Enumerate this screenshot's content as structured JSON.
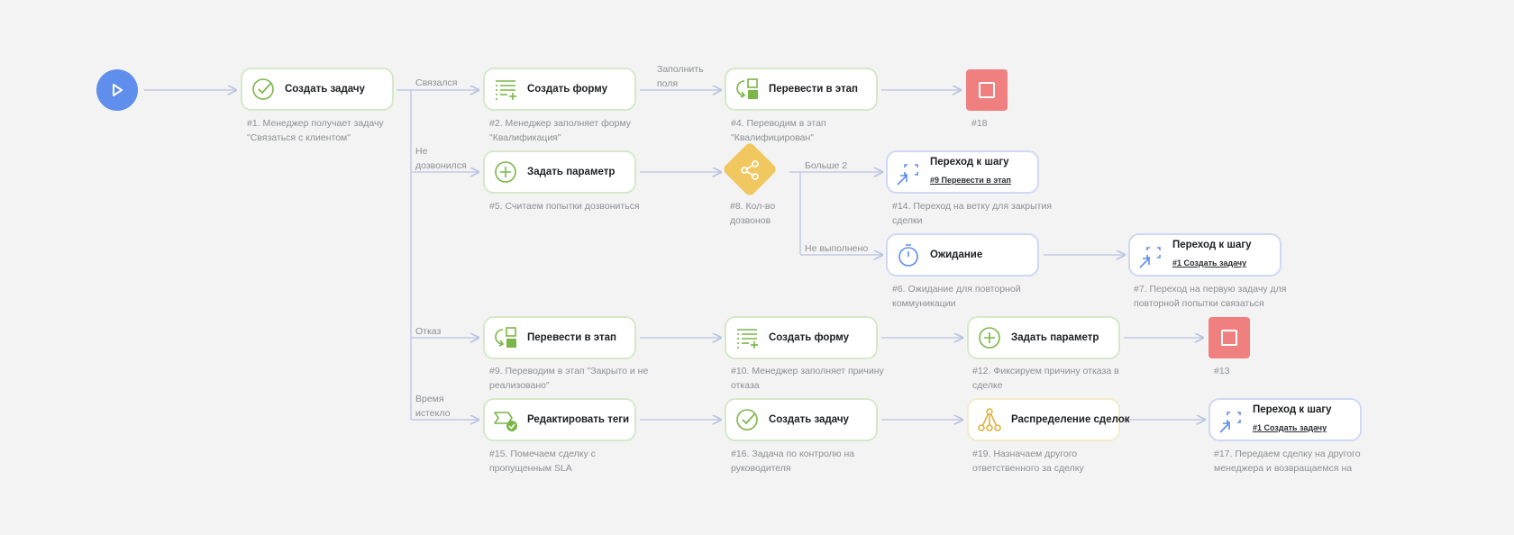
{
  "nodes": {
    "n1": {
      "title": "Создать задачу",
      "caption": "#1. Менеджер получает задачу \"Связаться с клиентом\""
    },
    "n2": {
      "title": "Создать форму",
      "caption": "#2. Менеджер заполняет форму \"Квалификация\""
    },
    "n4": {
      "title": "Перевести в этап",
      "caption": "#4. Переводим в этап \"Квалифицирован\""
    },
    "n18": {
      "caption": "#18"
    },
    "n5": {
      "title": "Задать параметр",
      "caption": "#5. Считаем попытки дозвониться"
    },
    "n8": {
      "caption": "#8. Кол-во дозвонов"
    },
    "n14": {
      "title": "Переход к шагу",
      "link": "#9 Перевести в этап",
      "caption": "#14. Переход на ветку для закрытия сделки"
    },
    "n6": {
      "title": "Ожидание",
      "caption": "#6. Ожидание для повторной коммуникации"
    },
    "n7": {
      "title": "Переход к шагу",
      "link": "#1 Создать задачу",
      "caption": "#7. Переход на первую задачу для повторной попытки связаться"
    },
    "n9": {
      "title": "Перевести в этап",
      "caption": "#9. Переводим в этап \"Закрыто и не реализовано\""
    },
    "n10": {
      "title": "Создать форму",
      "caption": "#10. Менеджер заполняет причину отказа"
    },
    "n12": {
      "title": "Задать параметр",
      "caption": "#12. Фиксируем причину отказа в сделке"
    },
    "n13": {
      "caption": "#13"
    },
    "n15": {
      "title": "Редактировать теги",
      "caption": "#15. Помечаем сделку с пропущенным SLA"
    },
    "n16": {
      "title": "Создать задачу",
      "caption": "#16. Задача по контролю на руководителя"
    },
    "n19": {
      "title": "Распределение сделок",
      "caption": "#19. Назначаем другого ответственного за сделку"
    },
    "n17": {
      "title": "Переход к шагу",
      "link": "#1 Создать задачу",
      "caption": "#17. Передаем сделку на другого менеджера и возвращаемся на"
    }
  },
  "edge_labels": {
    "svyazalsya": "Связался",
    "ne_dozvonilsya": "Не дозвонился",
    "otkaz": "Отказ",
    "vremya_isteklo": "Время истекло",
    "zapolnit_polya": "Заполнить поля",
    "bolshe_2": "Больше 2",
    "ne_vypolneno": "Не выполнено"
  },
  "colors": {
    "start": "#5f8eec",
    "stop": "#f08080",
    "condition": "#f1c85f",
    "green_icon": "#7ab648",
    "blue_icon": "#5f8eec",
    "yellow_icon": "#e0b23c",
    "wire": "#c2cbe3"
  },
  "icons": [
    "play-icon",
    "check-circle-icon",
    "form-list-icon",
    "stage-move-icon",
    "stop-icon",
    "plus-circle-icon",
    "share-branch-icon",
    "jump-arrow-icon",
    "timer-icon",
    "tag-edit-icon",
    "distribution-icon"
  ]
}
